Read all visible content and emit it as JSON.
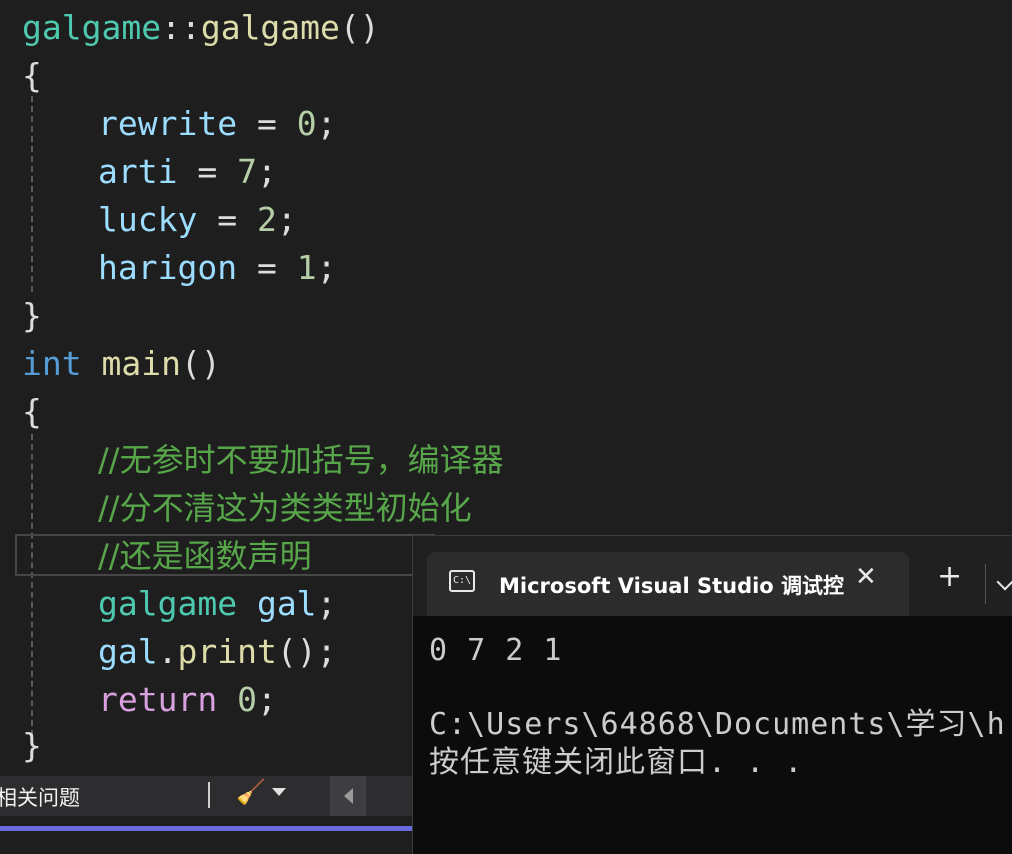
{
  "editor": {
    "l1": {
      "cls": "galgame",
      "sep": "::",
      "ctor": "galgame",
      "parens": "()"
    },
    "l2": "{",
    "l3": {
      "name": "rewrite",
      "eq": " = ",
      "val": "0",
      "semi": ";"
    },
    "l4": {
      "name": "arti",
      "eq": " = ",
      "val": "7",
      "semi": ";"
    },
    "l5": {
      "name": "lucky",
      "eq": " = ",
      "val": "2",
      "semi": ";"
    },
    "l6": {
      "name": "harigon",
      "eq": " = ",
      "val": "1",
      "semi": ";"
    },
    "l7": "}",
    "l8": {
      "kw": "int",
      "name": " main",
      "parens": "()"
    },
    "l9": "{",
    "c1": "//无参时不要加括号，编译器",
    "c2": "//分不清这为类类型初始化",
    "c3": "//还是函数声明",
    "l13": {
      "type": "galgame",
      "var": " gal",
      "semi": ";"
    },
    "l14": {
      "obj": "gal",
      "dot": ".",
      "method": "print",
      "rest": "();"
    },
    "l15": {
      "kw": "return",
      "val": " 0",
      "semi": ";"
    },
    "l16": "}"
  },
  "bottom_bar": {
    "label": "相关问题",
    "broom_icon": "🧹"
  },
  "terminal": {
    "tab_title": "Microsoft Visual Studio 调试控",
    "tab_icon_text": "C:\\",
    "close_glyph": "✕",
    "new_tab_glyph": "+",
    "output": [
      "0 7 2 1",
      "",
      "C:\\Users\\64868\\Documents\\学习\\h",
      "按任意键关闭此窗口. . ."
    ]
  }
}
